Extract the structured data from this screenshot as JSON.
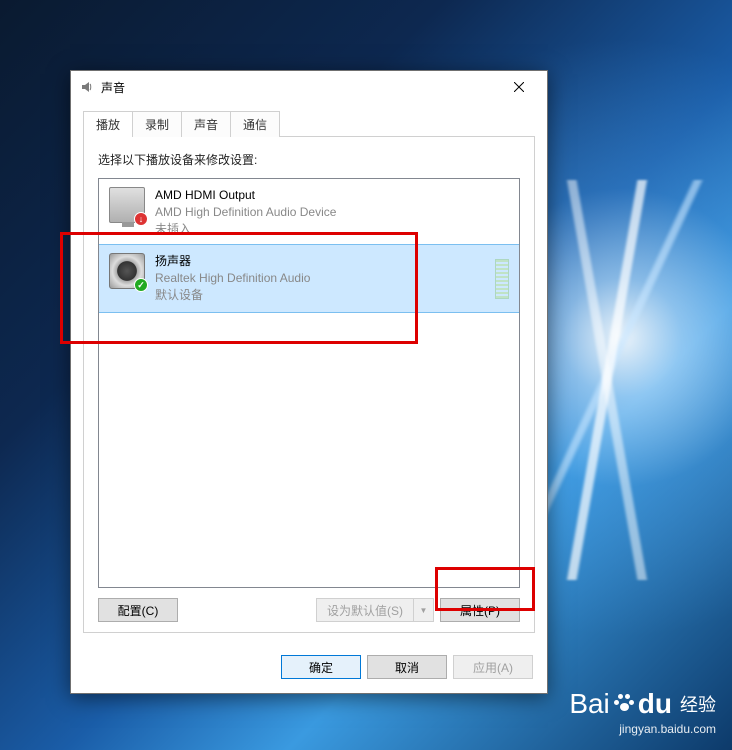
{
  "dialog": {
    "title": "声音",
    "tabs": [
      "播放",
      "录制",
      "声音",
      "通信"
    ],
    "active_tab": 0,
    "prompt": "选择以下播放设备来修改设置:",
    "devices": [
      {
        "name": "AMD HDMI Output",
        "desc": "AMD High Definition Audio Device",
        "status": "未插入",
        "icon": "monitor",
        "badge": "down",
        "selected": false
      },
      {
        "name": "扬声器",
        "desc": "Realtek High Definition Audio",
        "status": "默认设备",
        "icon": "speaker",
        "badge": "check",
        "selected": true
      }
    ],
    "configure_label": "配置(C)",
    "set_default_label": "设为默认值(S)",
    "properties_label": "属性(P)",
    "ok_label": "确定",
    "cancel_label": "取消",
    "apply_label": "应用(A)"
  },
  "watermark": {
    "brand_a": "Bai",
    "brand_b": "du",
    "brand_cn": "经验",
    "url": "jingyan.baidu.com"
  }
}
